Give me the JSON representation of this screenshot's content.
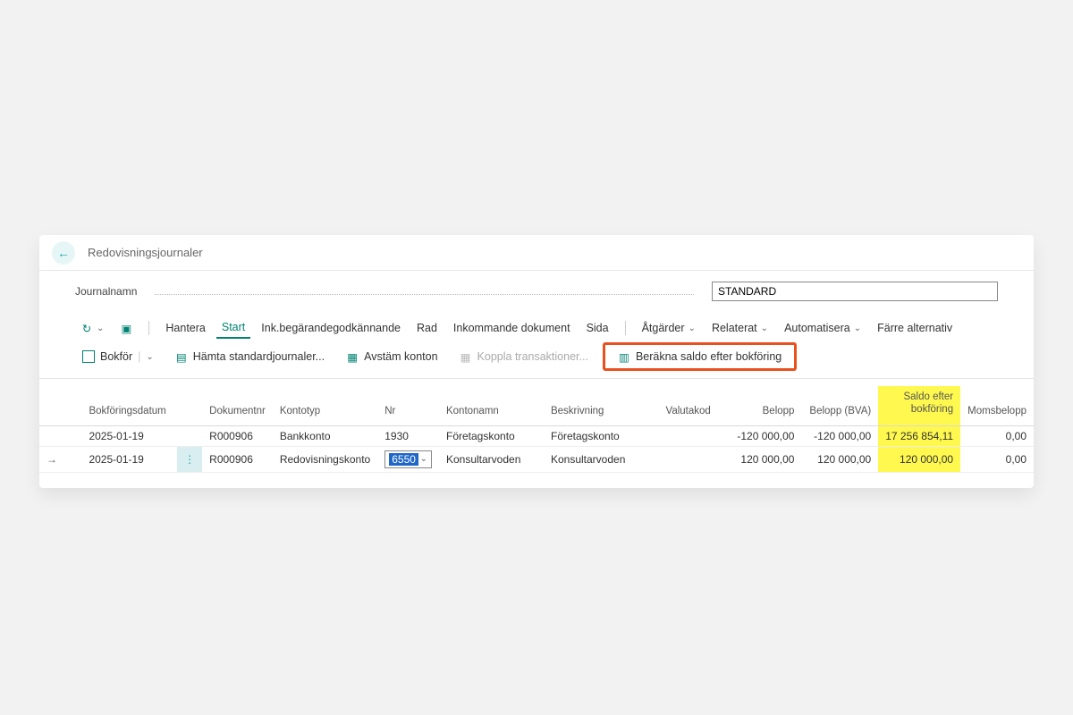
{
  "page": {
    "title": "Redovisningsjournaler"
  },
  "form": {
    "journal_label": "Journalnamn",
    "journal_value": "STANDARD"
  },
  "ribbon": {
    "hantera": "Hantera",
    "start": "Start",
    "inkbegar": "Ink.begärandegodkännande",
    "rad": "Rad",
    "inkdok": "Inkommande dokument",
    "sida": "Sida",
    "atgarder": "Åtgärder",
    "relaterat": "Relaterat",
    "automatisera": "Automatisera",
    "farre": "Färre alternativ"
  },
  "ribbon2": {
    "bokfor": "Bokför",
    "hamta": "Hämta standardjournaler...",
    "avstam": "Avstäm konton",
    "koppla": "Koppla transaktioner...",
    "berakna": "Beräkna saldo efter bokföring"
  },
  "table": {
    "headers": {
      "bokforingsdatum": "Bokföringsdatum",
      "dokumentnr": "Dokumentnr",
      "kontotyp": "Kontotyp",
      "nr": "Nr",
      "kontonamn": "Kontonamn",
      "beskrivning": "Beskrivning",
      "valutakod": "Valutakod",
      "belopp": "Belopp",
      "belopp_bva": "Belopp (BVA)",
      "saldo_efter": "Saldo efter bokföring",
      "momsbelopp": "Momsbelopp"
    },
    "rows": [
      {
        "active": false,
        "bokforingsdatum": "2025-01-19",
        "dokumentnr": "R000906",
        "kontotyp": "Bankkonto",
        "nr": "1930",
        "kontonamn": "Företagskonto",
        "beskrivning": "Företagskonto",
        "valutakod": "",
        "belopp": "-120 000,00",
        "belopp_bva": "-120 000,00",
        "saldo_efter": "17 256 854,11",
        "momsbelopp": "0,00"
      },
      {
        "active": true,
        "bokforingsdatum": "2025-01-19",
        "dokumentnr": "R000906",
        "kontotyp": "Redovisningskonto",
        "nr": "6550",
        "kontonamn": "Konsultarvoden",
        "beskrivning": "Konsultarvoden",
        "valutakod": "",
        "belopp": "120 000,00",
        "belopp_bva": "120 000,00",
        "saldo_efter": "120 000,00",
        "momsbelopp": "0,00"
      }
    ]
  }
}
